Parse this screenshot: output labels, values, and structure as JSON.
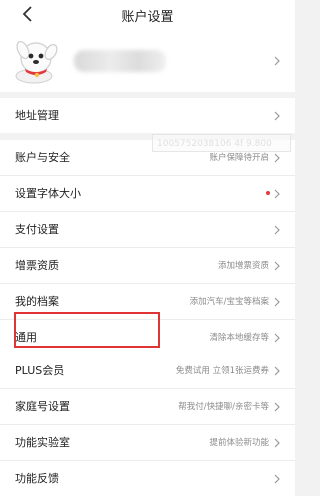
{
  "header": {
    "title": "账户设置",
    "back_icon": "chevron-left-icon"
  },
  "profile": {
    "avatar_icon": "mascot-dog-icon",
    "chevron_icon": "chevron-right-icon"
  },
  "address_group": [
    {
      "label": "地址管理",
      "value": ""
    }
  ],
  "watermark_text": "1005752038106 4f 9.800",
  "settings_group_1": [
    {
      "label": "账户与安全",
      "value": "账户保障待开启"
    },
    {
      "label": "设置字体大小",
      "value": "",
      "badge": "dot"
    },
    {
      "label": "支付设置",
      "value": ""
    },
    {
      "label": "增票资质",
      "value": "添加增票资质"
    },
    {
      "label": "我的档案",
      "value": "添加汽车/宝宝等档案"
    },
    {
      "label": "通用",
      "value": "清除本地缓存等"
    }
  ],
  "settings_group_2": [
    {
      "label": "PLUS会员",
      "value": "免费试用 立领1张运费券"
    },
    {
      "label": "家庭号设置",
      "value": "帮我付/快捷聊/亲密卡等"
    },
    {
      "label": "功能实验室",
      "value": "提前体验新功能"
    },
    {
      "label": "功能反馈",
      "value": ""
    }
  ],
  "colors": {
    "accent_red": "#e4393c",
    "highlight_red": "#e03333",
    "background": "#f2f2f2"
  }
}
